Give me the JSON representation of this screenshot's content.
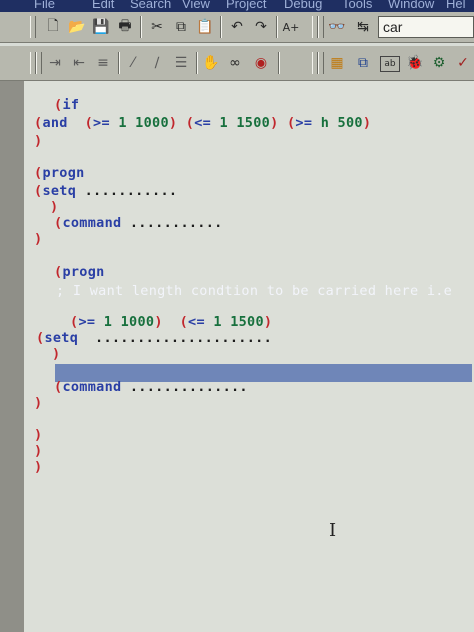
{
  "menu": [
    "File",
    "Edit",
    "Search",
    "View",
    "Project",
    "Debug",
    "Tools",
    "Window",
    "Hel"
  ],
  "toolbar": {
    "search_value": "car",
    "icons_row1": [
      "new-file-icon",
      "open-folder-icon",
      "save-icon",
      "print-icon",
      "cut-icon",
      "copy-icon",
      "paste-icon",
      "undo-icon",
      "redo-icon",
      "font-size-icon",
      "find-icon",
      "replace-icon"
    ],
    "icons_row2": [
      "indent-icon",
      "outdent-icon",
      "comment-icon",
      "uncomment-icon",
      "format-icon",
      "hand-icon",
      "glasses-icon",
      "stop-icon",
      "load-icon",
      "window-icon",
      "text-icon",
      "debug-icon",
      "tools-icon"
    ]
  },
  "code": {
    "l1": [
      "(",
      "if"
    ],
    "l2": [
      "(",
      "and",
      "(",
      ">=",
      "1 1000",
      ")",
      "(",
      "<=",
      "1 1500",
      ")",
      "(",
      ">=",
      "h 500",
      ")"
    ],
    "l3": [
      ")"
    ],
    "l4": [
      "(",
      "progn"
    ],
    "l5": [
      "(",
      "setq",
      "..........."
    ],
    "l6": [
      ")"
    ],
    "l7": [
      "(",
      "command",
      "..........."
    ],
    "l8": [
      ")"
    ],
    "l9": [
      "(",
      "progn"
    ],
    "l10": "; I want length condtion to be carried here i.e",
    "l11": [
      "(",
      ">=",
      "1 1000",
      ")",
      "(",
      "<=",
      "1 1500",
      ")"
    ],
    "l12": [
      "(",
      "setq",
      "....................."
    ],
    "l13": [
      ")"
    ],
    "l14": [
      "(",
      "command",
      ".............."
    ],
    "l15": [
      ")"
    ],
    "l16": [
      ")"
    ],
    "l17": [
      ")"
    ],
    "l18": [
      ")"
    ]
  },
  "colors": {
    "paren": "#c1272d",
    "keyword": "#2a3fa5",
    "number": "#17703d",
    "selection": "#6f86b8",
    "background": "#dcdfd8"
  }
}
